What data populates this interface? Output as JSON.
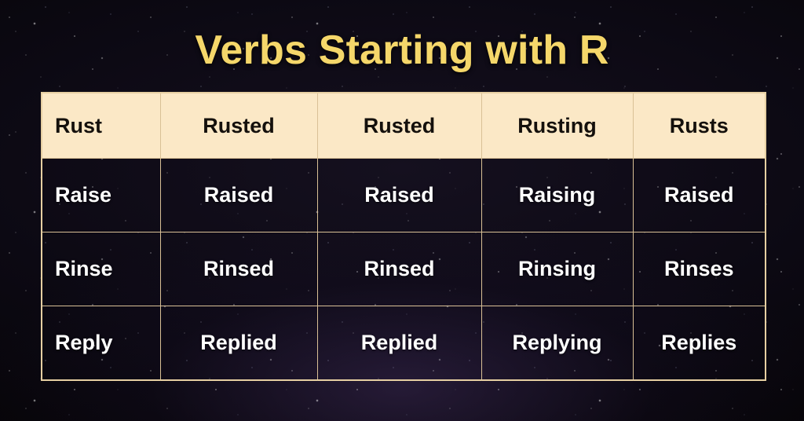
{
  "title": "Verbs Starting with R",
  "colors": {
    "title_text": "#f5d76a",
    "header_bg": "#fbe8c6",
    "header_text": "#14100c",
    "body_text": "#ffffff",
    "table_border": "#e6cfa2",
    "background": "#0c0913"
  },
  "table": {
    "header": {
      "base": "Rust",
      "past": "Rusted",
      "past_participle": "Rusted",
      "present_participle": "Rusting",
      "third_person": "Rusts"
    },
    "rows": [
      {
        "base": "Raise",
        "past": "Raised",
        "past_participle": "Raised",
        "present_participle": "Raising",
        "third_person": "Raised"
      },
      {
        "base": "Rinse",
        "past": "Rinsed",
        "past_participle": "Rinsed",
        "present_participle": "Rinsing",
        "third_person": "Rinses"
      },
      {
        "base": "Reply",
        "past": "Replied",
        "past_participle": "Replied",
        "present_participle": "Replying",
        "third_person": "Replies"
      }
    ]
  }
}
